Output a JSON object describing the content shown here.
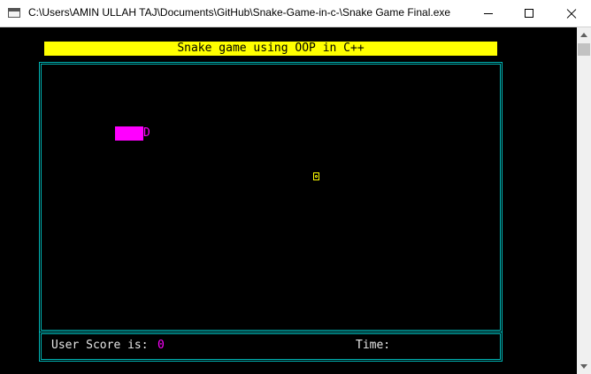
{
  "window": {
    "title": "C:\\Users\\AMIN ULLAH TAJ\\Documents\\GitHub\\Snake-Game-in-c-\\Snake Game Final.exe",
    "icon": "console-app-icon",
    "controls": [
      "minimize-icon",
      "maximize-icon",
      "close-icon"
    ]
  },
  "game": {
    "header": "Snake game using OOP in C++",
    "score_label": "User Score is:",
    "score_value": "0",
    "time_label": "Time:",
    "snake_head_char": "D",
    "food_icon": "food-icon"
  },
  "colors": {
    "background": "#000000",
    "header_bg": "#ffff00",
    "border": "#00b4b4",
    "snake": "#ff00ff",
    "food": "#ffff00",
    "score_value": "#ff00ff"
  }
}
